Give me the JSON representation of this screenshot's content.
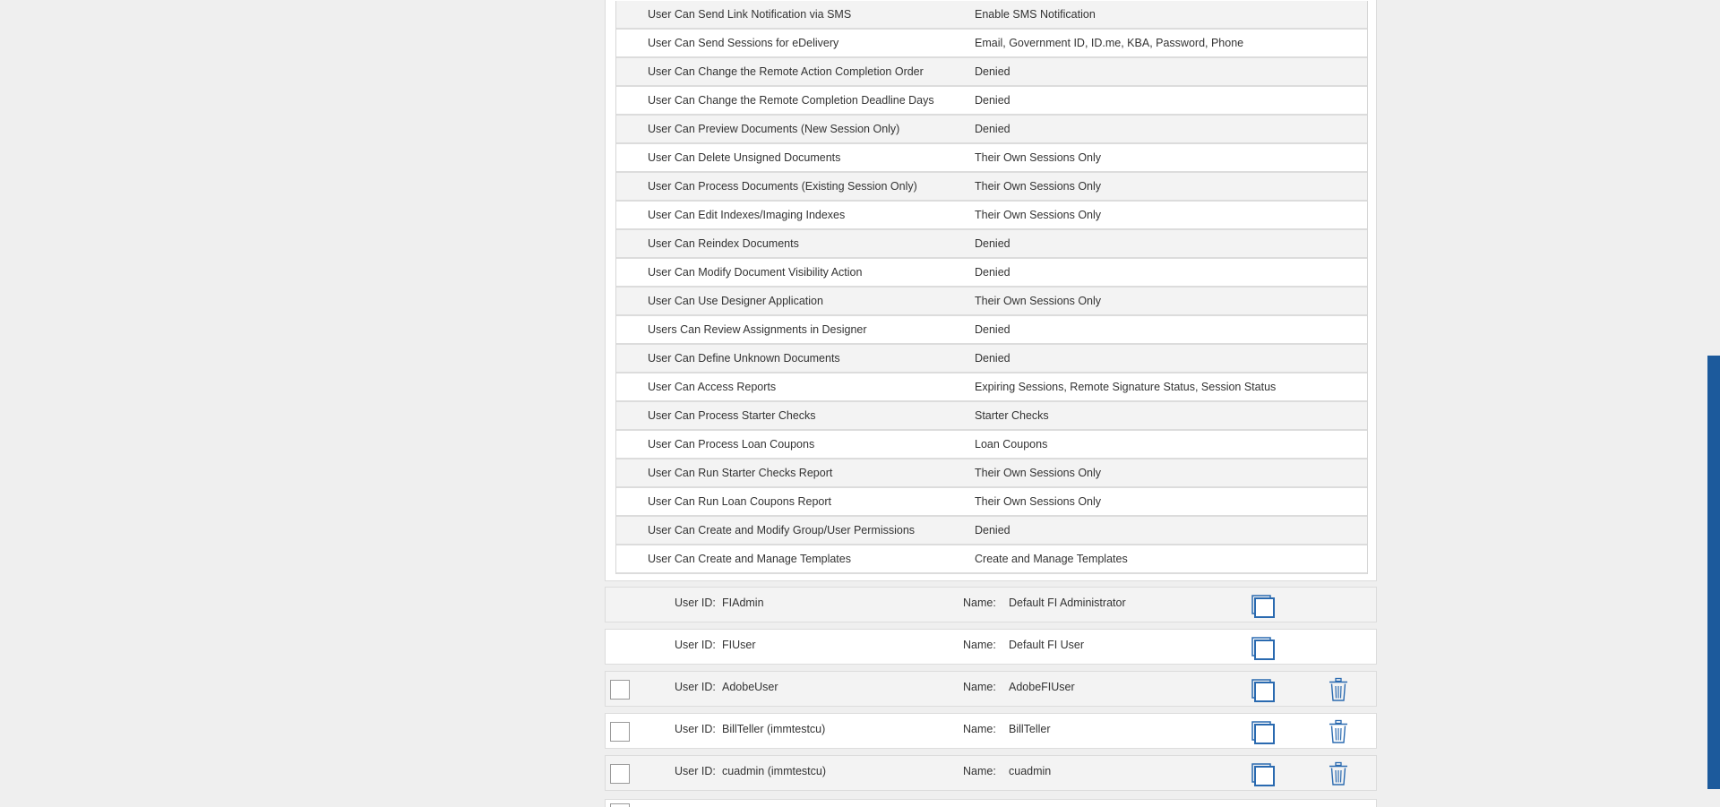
{
  "permissions": [
    {
      "name": "User Can Send Link Notification via SMS",
      "value": "Enable SMS Notification"
    },
    {
      "name": "User Can Send Sessions for eDelivery",
      "value": "Email, Government ID, ID.me, KBA, Password, Phone"
    },
    {
      "name": "User Can Change the Remote Action Completion Order",
      "value": "Denied"
    },
    {
      "name": "User Can Change the Remote Completion Deadline Days",
      "value": "Denied"
    },
    {
      "name": "User Can Preview Documents (New Session Only)",
      "value": "Denied"
    },
    {
      "name": "User Can Delete Unsigned Documents",
      "value": "Their Own Sessions Only"
    },
    {
      "name": "User Can Process Documents (Existing Session Only)",
      "value": "Their Own Sessions Only"
    },
    {
      "name": "User Can Edit Indexes/Imaging Indexes",
      "value": "Their Own Sessions Only"
    },
    {
      "name": "User Can Reindex Documents",
      "value": "Denied"
    },
    {
      "name": "User Can Modify Document Visibility Action",
      "value": "Denied"
    },
    {
      "name": "User Can Use Designer Application",
      "value": "Their Own Sessions Only"
    },
    {
      "name": "Users Can Review Assignments in Designer",
      "value": "Denied"
    },
    {
      "name": "User Can Define Unknown Documents",
      "value": "Denied"
    },
    {
      "name": "User Can Access Reports",
      "value": "Expiring Sessions, Remote Signature Status, Session Status"
    },
    {
      "name": "User Can Process Starter Checks",
      "value": "Starter Checks"
    },
    {
      "name": "User Can Process Loan Coupons",
      "value": "Loan Coupons"
    },
    {
      "name": "User Can Run Starter Checks Report",
      "value": "Their Own Sessions Only"
    },
    {
      "name": "User Can Run Loan Coupons Report",
      "value": "Their Own Sessions Only"
    },
    {
      "name": "User Can Create and Modify Group/User Permissions",
      "value": "Denied"
    },
    {
      "name": "User Can Create and Manage Templates",
      "value": "Create and Manage Templates"
    }
  ],
  "labels": {
    "user_id": "User ID:",
    "name": "Name:"
  },
  "users": [
    {
      "user_id": "FIAdmin",
      "name": "Default FI Administrator",
      "selectable": false,
      "deletable": false
    },
    {
      "user_id": "FIUser",
      "name": "Default FI User",
      "selectable": false,
      "deletable": false
    },
    {
      "user_id": "AdobeUser",
      "name": "AdobeFIUser",
      "selectable": true,
      "deletable": true
    },
    {
      "user_id": "BillTeller (immtestcu)",
      "name": "BillTeller",
      "selectable": true,
      "deletable": true
    },
    {
      "user_id": "cuadmin (immtestcu)",
      "name": "cuadmin",
      "selectable": true,
      "deletable": true
    }
  ],
  "icons": {
    "copy": "copy-icon",
    "delete": "trash-icon"
  },
  "colors": {
    "accent": "#1c5a9c",
    "icon": "#2a6ab0"
  }
}
